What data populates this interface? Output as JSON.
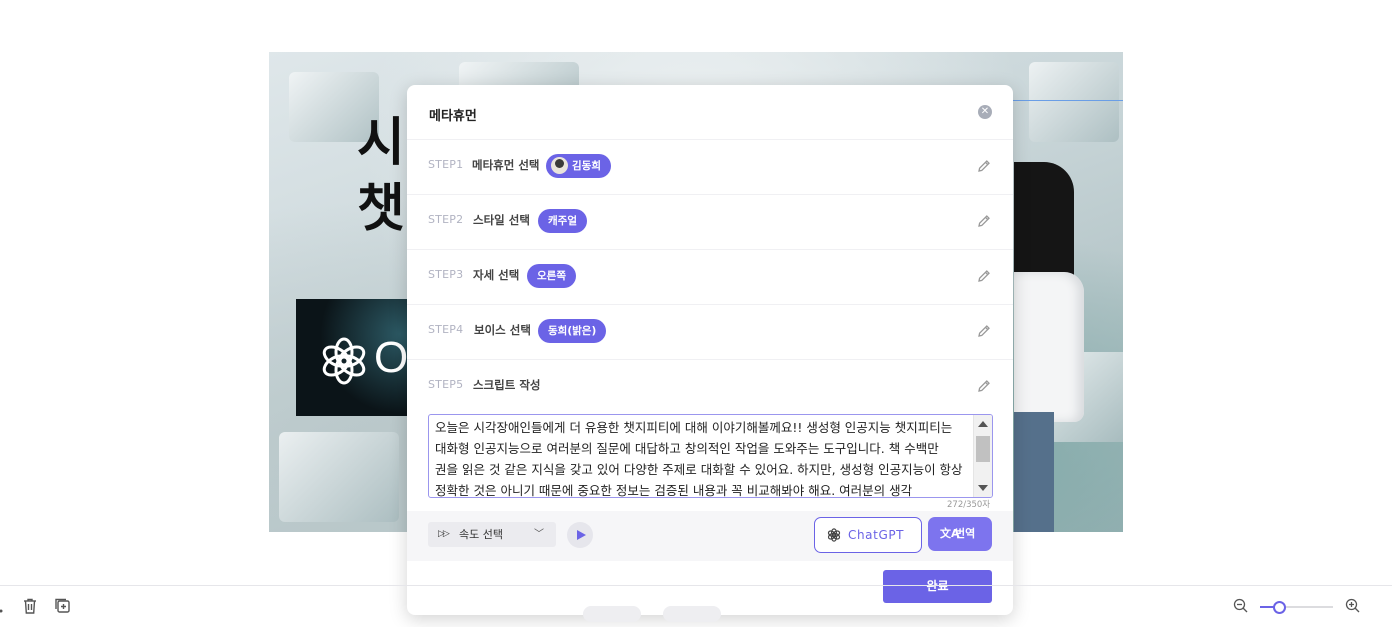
{
  "slide": {
    "title_line1": "시",
    "title_line2": "챗",
    "logo_text": "O"
  },
  "modal": {
    "title": "메타휴먼",
    "close_icon": "close-icon",
    "steps": [
      {
        "num": "STEP1",
        "label": "메타휴먼 선택",
        "value": "김동희",
        "has_avatar": true
      },
      {
        "num": "STEP2",
        "label": "스타일 선택",
        "value": "캐주얼"
      },
      {
        "num": "STEP3",
        "label": "자세 선택",
        "value": "오른쪽"
      },
      {
        "num": "STEP4",
        "label": "보이스 선택",
        "value": "동희(밝은)"
      },
      {
        "num": "STEP5",
        "label": "스크립트 작성",
        "value": ""
      }
    ],
    "script": "오늘은 시각장애인들에게 더 유용한 챗지피티에 대해 이야기해볼께요!! 생성형 인공지능 챗지피티는 대화형 인공지능으로 여러분의 질문에 대답하고 창의적인 작업을 도와주는 도구입니다.  책 수백만 권을 읽은 것 같은 지식을 갖고 있어 다양한 주제로 대화할 수 있어요. 하지만, 생성형 인공지능이 항상 정확한 것은 아니기 때문에 중요한 정보는 검증된 내용과 꼭 비교해봐야 해요. 여러분의 생각",
    "char_count": "272/350자",
    "speed_label": "속도 선택",
    "chatgpt_label": "ChatGPT",
    "translate_label": "번역",
    "done_label": "완료"
  },
  "colors": {
    "accent": "#6b63e6",
    "badge": "#6b63e6",
    "step_num": "#b1b3c2"
  },
  "zoom": {
    "level": 0.25
  }
}
